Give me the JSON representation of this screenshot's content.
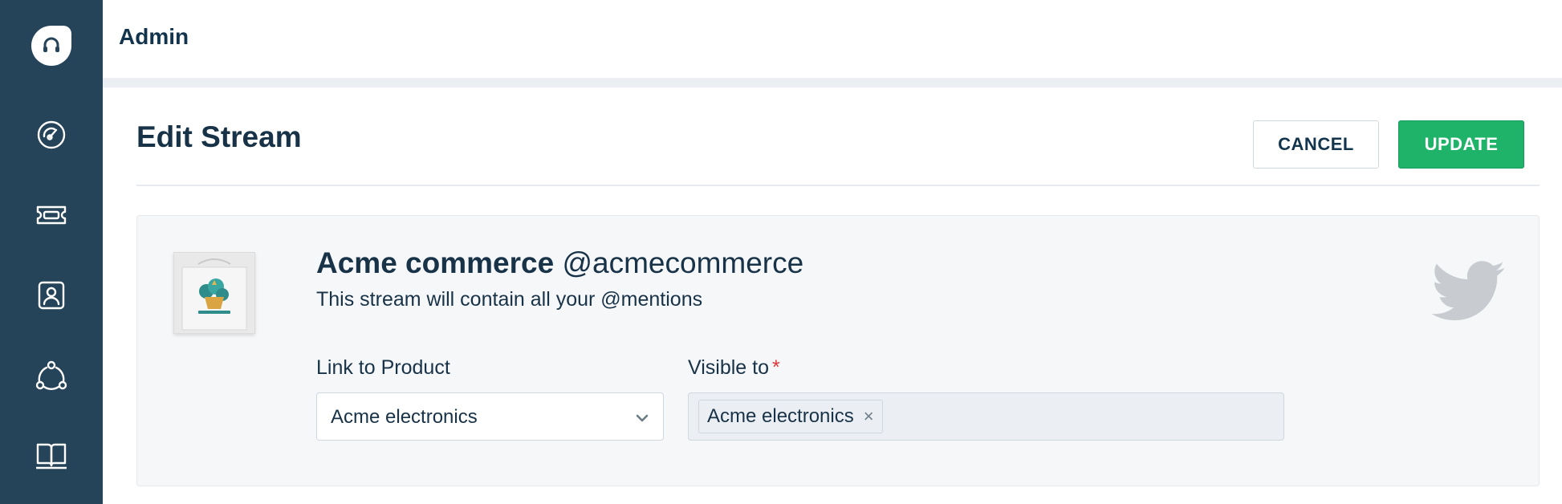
{
  "sidebar": {
    "items": [
      {
        "icon": "headset-logo-icon"
      },
      {
        "icon": "dashboard-gauge-icon"
      },
      {
        "icon": "ticket-icon"
      },
      {
        "icon": "contact-icon"
      },
      {
        "icon": "social-network-icon"
      },
      {
        "icon": "book-icon"
      }
    ]
  },
  "header": {
    "title": "Admin"
  },
  "page": {
    "title": "Edit Stream",
    "cancel_label": "CANCEL",
    "update_label": "UPDATE"
  },
  "stream": {
    "name": "Acme commerce",
    "handle": "@acmecommerce",
    "description": "This stream will contain all your @mentions",
    "network_icon": "twitter-bird-icon",
    "link_to_product": {
      "label": "Link to Product",
      "value": "Acme electronics"
    },
    "visible_to": {
      "label": "Visible to",
      "required_mark": "*",
      "chips": [
        "Acme electronics"
      ],
      "remove_glyph": "×"
    }
  },
  "colors": {
    "sidebar": "#264459",
    "primary_button": "#1fb36a",
    "required": "#e43538",
    "card_background": "#f5f7f9"
  }
}
